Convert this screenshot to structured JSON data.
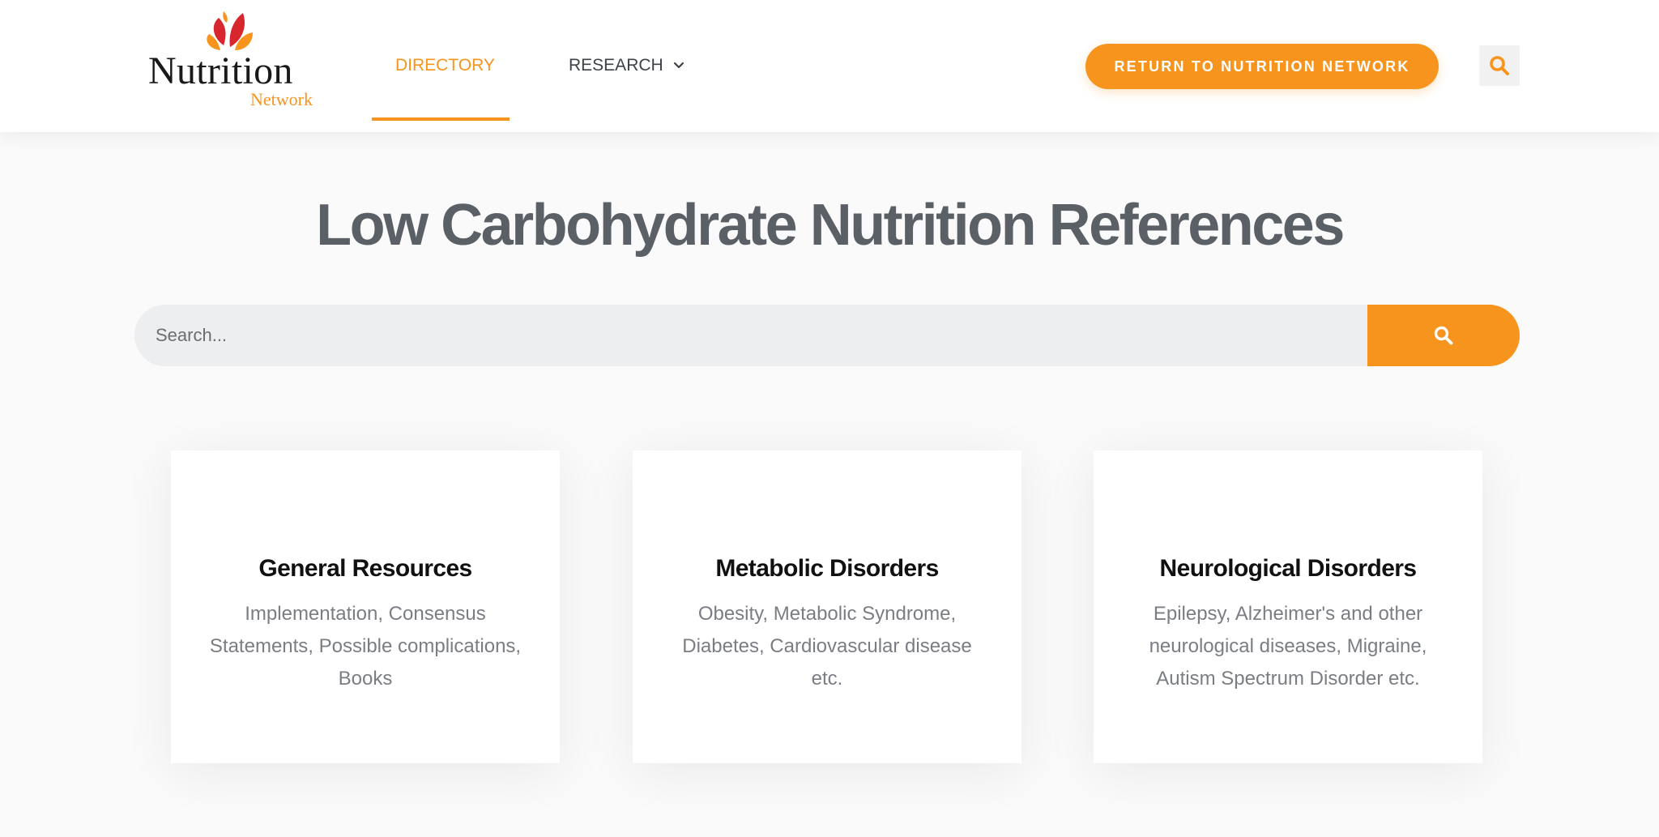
{
  "logo": {
    "word": "Nutrition",
    "sub": "Network"
  },
  "nav": {
    "directory": "DIRECTORY",
    "research": "RESEARCH"
  },
  "header": {
    "return_button": "RETURN TO NUTRITION NETWORK"
  },
  "page": {
    "title": "Low Carbohydrate Nutrition References"
  },
  "search": {
    "placeholder": "Search..."
  },
  "cards": [
    {
      "title": "General Resources",
      "description": "Implementation, Consensus Statements, Possible complications, Books"
    },
    {
      "title": "Metabolic Disorders",
      "description": "Obesity, Metabolic Syndrome, Diabetes, Cardiovascular disease etc."
    },
    {
      "title": "Neurological Disorders",
      "description": "Epilepsy, Alzheimer's and other neurological diseases, Migraine, Autism Spectrum Disorder etc."
    }
  ],
  "colors": {
    "accent": "#f7941d",
    "logo_red": "#d7262e",
    "title": "#5b6066"
  },
  "icons": {
    "header_search": "search-icon",
    "search_submit": "search-icon",
    "research_dropdown": "chevron-down-icon",
    "logo": "leaf-logo-icon"
  }
}
